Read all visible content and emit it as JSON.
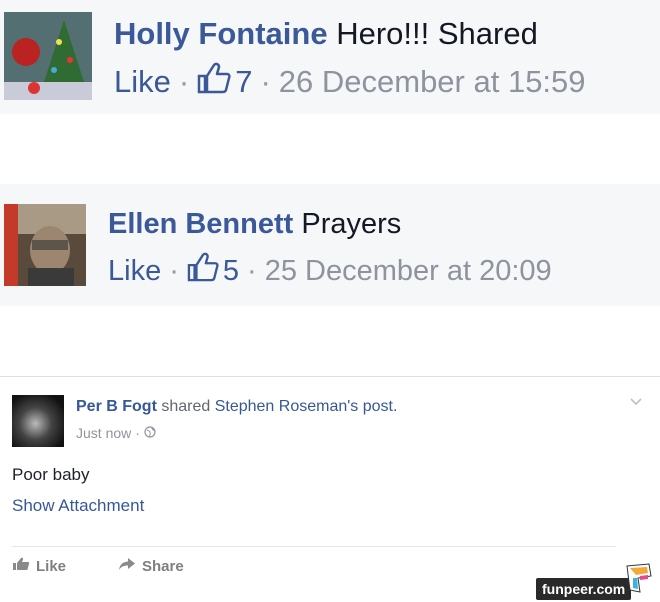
{
  "comments": [
    {
      "author": "Holly Fontaine",
      "text": "Hero!!! Shared",
      "like_label": "Like",
      "separator": "·",
      "likes": "7",
      "timestamp": "26 December at 15:59"
    },
    {
      "author": "Ellen Bennett",
      "text": "Prayers",
      "like_label": "Like",
      "separator": "·",
      "likes": "5",
      "timestamp": "25 December at 20:09"
    }
  ],
  "post": {
    "author": "Per B Fogt",
    "shared_word": "shared",
    "shared_target": "Stephen Roseman's post.",
    "time": "Just now",
    "separator": "·",
    "body": "Poor baby",
    "attachment_link": "Show Attachment",
    "actions": {
      "like": "Like",
      "share": "Share"
    }
  },
  "watermark": "funpeer.com",
  "colors": {
    "fb_blue": "#3b5998",
    "meta_gray": "#8d949e",
    "comment_bg": "#f6f7f9"
  },
  "icons": [
    "thumbs-up-icon",
    "globe-icon",
    "chevron-down-icon",
    "like-icon",
    "share-icon",
    "funpeer-logo-icon"
  ]
}
